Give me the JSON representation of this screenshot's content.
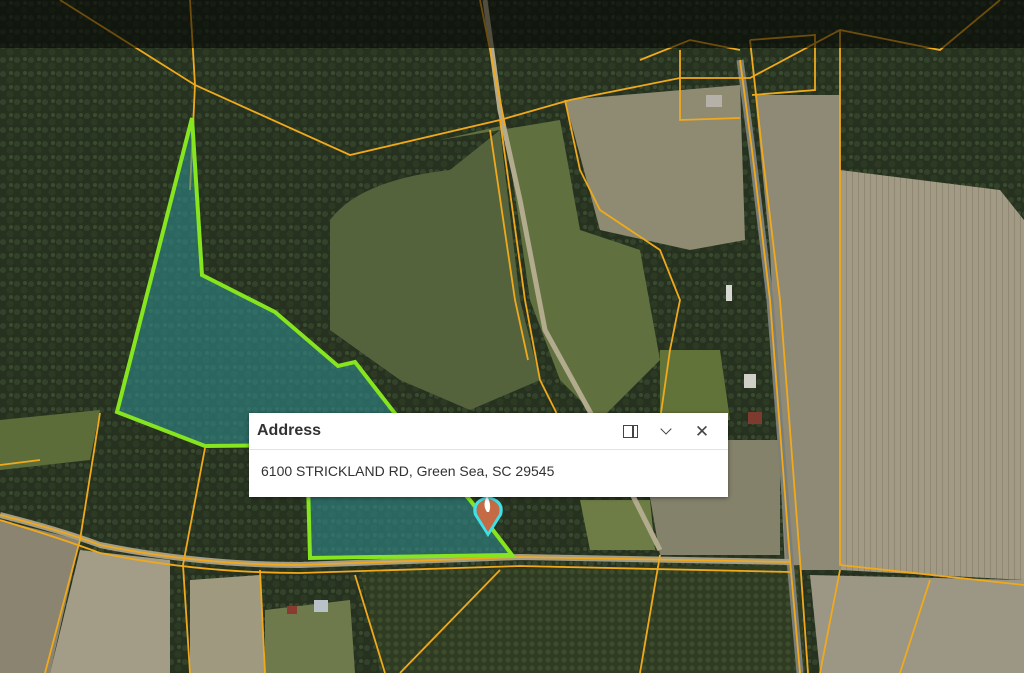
{
  "popup": {
    "title": "Address",
    "address": "6100 STRICKLAND RD, Green Sea, SC 29545",
    "actions": [
      "dock-icon",
      "chevron-down-icon",
      "close-icon"
    ]
  },
  "map": {
    "parcel_line_color": "#f0a91c",
    "selected_parcel_outline": "#86e51f",
    "selected_parcel_fill": "#2e8a8c",
    "marker_color": "#c46a45",
    "marker_outline": "#3fe0e8"
  }
}
